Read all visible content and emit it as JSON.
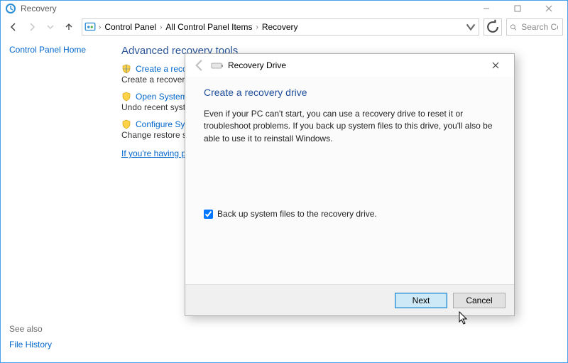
{
  "window": {
    "title": "Recovery"
  },
  "breadcrumbs": {
    "items": [
      "Control Panel",
      "All Control Panel Items",
      "Recovery"
    ]
  },
  "search": {
    "placeholder": "Search Co..."
  },
  "leftnav": {
    "home": "Control Panel Home"
  },
  "section": {
    "title": "Advanced recovery tools",
    "tools": [
      {
        "label": "Create a recovery drive",
        "desc": "Create a recovery drive to troubleshoot problems when your PC can't start."
      },
      {
        "label": "Open System Restore",
        "desc": "Undo recent system changes, but leave files such as documents, pictures, and music unchanged."
      },
      {
        "label": "Configure System Restore",
        "desc": "Change restore settings, manage disk space, and create or delete restore points."
      }
    ],
    "trouble": "If you're having problems with your PC, go to Settings and try resetting it"
  },
  "see_also": {
    "header": "See also",
    "link": "File History"
  },
  "dialog": {
    "app_title": "Recovery Drive",
    "title": "Create a recovery drive",
    "body": "Even if your PC can't start, you can use a recovery drive to reset it or troubleshoot problems. If you back up system files to this drive, you'll also be able to use it to reinstall Windows.",
    "checkbox_label": "Back up system files to the recovery drive.",
    "checkbox_checked": true,
    "next": "Next",
    "cancel": "Cancel"
  }
}
